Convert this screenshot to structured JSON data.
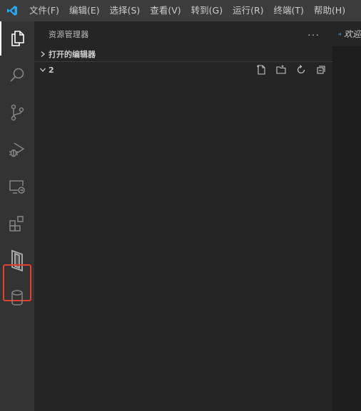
{
  "menu": {
    "logo_icon": "vscode-logo-icon",
    "items": [
      "文件(F)",
      "编辑(E)",
      "选择(S)",
      "查看(V)",
      "转到(G)",
      "运行(R)",
      "终端(T)",
      "帮助(H)"
    ]
  },
  "activitybar": {
    "items": [
      {
        "icon": "files-explorer-icon",
        "active": true
      },
      {
        "icon": "search-icon"
      },
      {
        "icon": "source-control-icon"
      },
      {
        "icon": "run-debug-icon"
      },
      {
        "icon": "remote-explorer-icon"
      },
      {
        "icon": "extensions-icon"
      },
      {
        "icon": "custom-extension-icon",
        "highlighted": true
      },
      {
        "icon": "database-icon"
      }
    ],
    "highlight_color": "#e0402f"
  },
  "sidebar": {
    "title": "资源管理器",
    "more_label": "···",
    "sections": [
      {
        "label": "打开的编辑器",
        "expanded": false
      },
      {
        "label": "2",
        "expanded": true
      }
    ],
    "folder_actions": [
      "new-file-icon",
      "new-folder-icon",
      "refresh-icon",
      "collapse-all-icon"
    ]
  },
  "editor": {
    "tab_title": "欢迎"
  }
}
